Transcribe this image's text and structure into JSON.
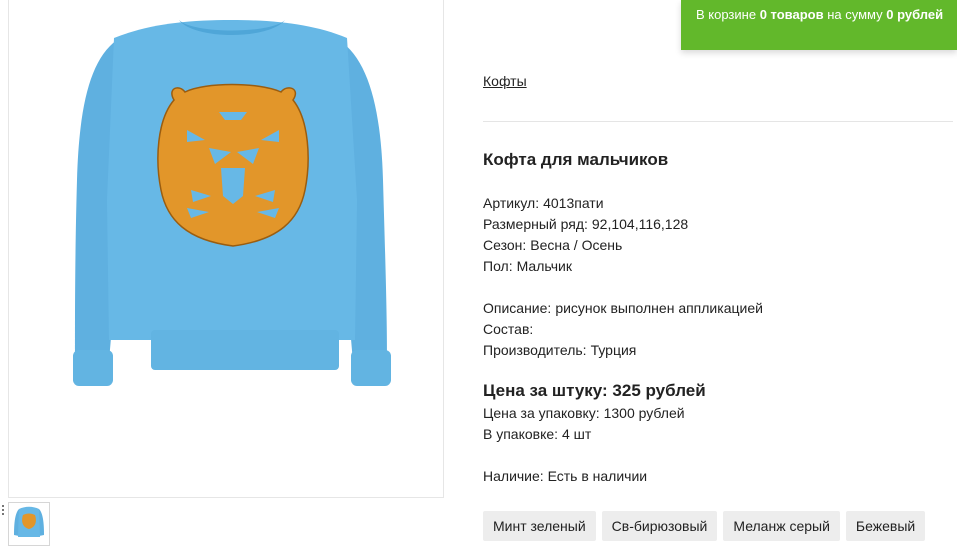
{
  "cart": {
    "prefix": "В корзине",
    "count": "0 товаров",
    "middle": "на сумму",
    "sum": "0 рублей"
  },
  "breadcrumb": "Кофты",
  "product": {
    "title": "Кофта для мальчиков",
    "article_label": "Артикул:",
    "article_value": "4013пати",
    "sizes_label": "Размерный ряд:",
    "sizes_value": "92,104,116,128",
    "season_label": "Сезон:",
    "season_value": "Весна / Осень",
    "gender_label": "Пол:",
    "gender_value": "Мальчик",
    "description_label": "Описание:",
    "description_value": "рисунок выполнен аппликацией",
    "composition_label": "Состав:",
    "composition_value": "",
    "maker_label": "Производитель:",
    "maker_value": "Турция",
    "price_unit": "Цена за штуку: 325 рублей",
    "price_pack": "Цена за упаковку: 1300 рублей",
    "pack_qty": "В упаковке: 4 шт",
    "availability": "Наличие: Есть в наличии"
  },
  "colors": [
    "Минт зеленый",
    "Св-бирюзовый",
    "Меланж серый",
    "Бежевый"
  ],
  "palette": {
    "sweater": "#67b8e6",
    "tiger": "#e2962a",
    "cart_green": "#62b82b"
  }
}
